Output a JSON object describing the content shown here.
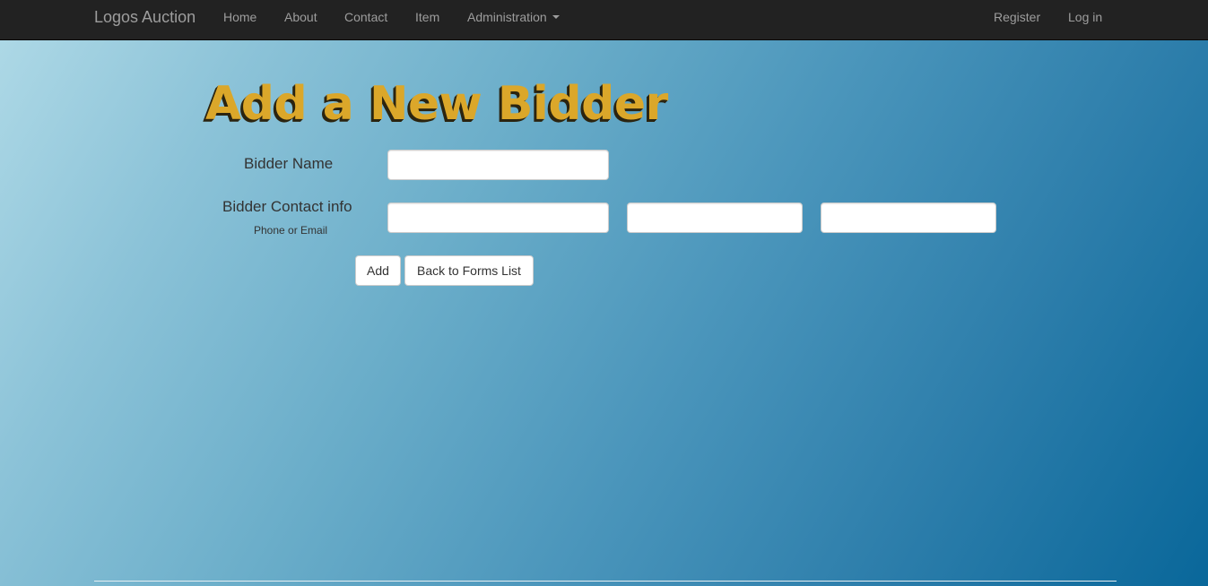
{
  "navbar": {
    "brand": "Logos Auction",
    "links": [
      "Home",
      "About",
      "Contact",
      "Item",
      "Administration"
    ],
    "right_links": [
      "Register",
      "Log in"
    ]
  },
  "page": {
    "title": "Add a New Bidder"
  },
  "form": {
    "bidder_name_label": "Bidder Name",
    "bidder_name_value": "",
    "contact_label": "Bidder Contact info",
    "contact_sublabel": "Phone or Email",
    "contact_values": [
      "",
      "",
      ""
    ],
    "add_label": "Add",
    "back_label": "Back to Forms List"
  },
  "colors": {
    "navbar_bg": "#222222",
    "nav_text": "#9d9d9d",
    "title": "#dba72a",
    "background_start": "#b0dae7",
    "background_end": "#09679a"
  }
}
